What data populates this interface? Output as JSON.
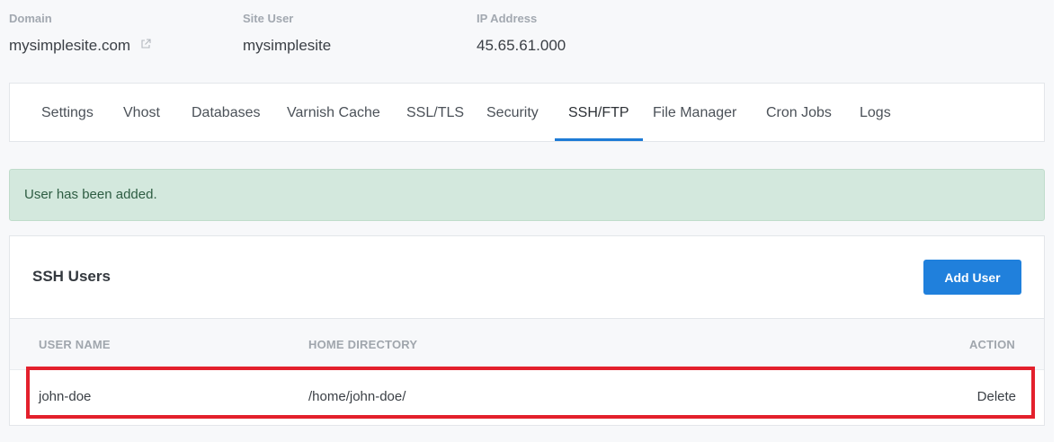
{
  "header": {
    "domain_label": "Domain",
    "domain_value": "mysimplesite.com",
    "site_user_label": "Site User",
    "site_user_value": "mysimplesite",
    "ip_label": "IP Address",
    "ip_value": "45.65.61.000"
  },
  "tabs": [
    {
      "label": "Settings"
    },
    {
      "label": "Vhost"
    },
    {
      "label": "Databases"
    },
    {
      "label": "Varnish Cache"
    },
    {
      "label": "SSL/TLS"
    },
    {
      "label": "Security"
    },
    {
      "label": "SSH/FTP",
      "active": true
    },
    {
      "label": "File Manager"
    },
    {
      "label": "Cron Jobs"
    },
    {
      "label": "Logs"
    }
  ],
  "alert": {
    "message": "User has been added."
  },
  "card": {
    "title": "SSH Users",
    "add_button": "Add User",
    "columns": [
      "USER NAME",
      "HOME DIRECTORY",
      "ACTION"
    ],
    "rows": [
      {
        "user_name": "john-doe",
        "home_directory": "/home/john-doe/",
        "action": "Delete"
      }
    ]
  },
  "colors": {
    "accent": "#2080dc",
    "alert_bg": "#d3e8dd",
    "highlight": "#e3202c"
  }
}
